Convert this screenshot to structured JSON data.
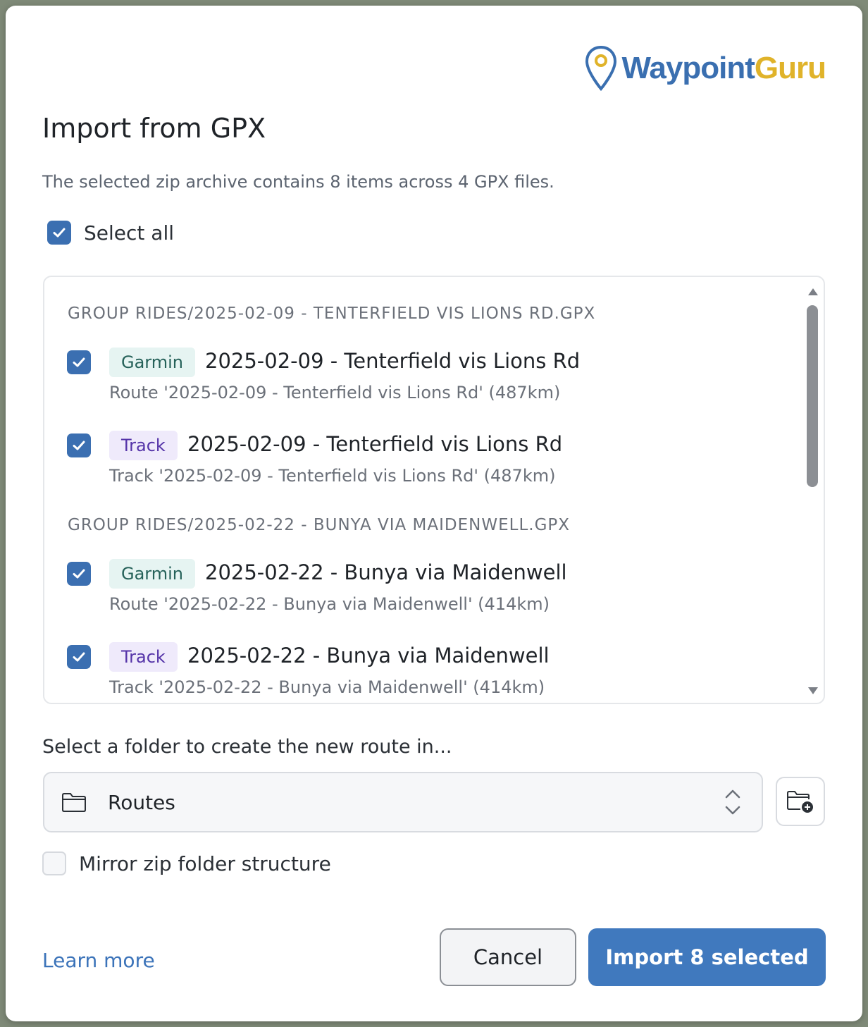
{
  "logo": {
    "text_part1": "Waypoint",
    "text_part2": "Guru"
  },
  "dialog": {
    "title": "Import from GPX",
    "subtitle": "The selected zip archive contains 8 items across 4 GPX files.",
    "select_all_label": "Select all",
    "select_all_checked": true
  },
  "groups": [
    {
      "heading": "GROUP RIDES/2025-02-09 - TENTERFIELD VIS LIONS RD.GPX",
      "items": [
        {
          "badge": "Garmin",
          "title": "2025-02-09 - Tenterfield vis Lions Rd",
          "desc": "Route '2025-02-09 - Tenterfield vis Lions Rd' (487km)",
          "checked": true
        },
        {
          "badge": "Track",
          "title": "2025-02-09 - Tenterfield vis Lions Rd",
          "desc": "Track '2025-02-09 - Tenterfield vis Lions Rd' (487km)",
          "checked": true
        }
      ]
    },
    {
      "heading": "GROUP RIDES/2025-02-22 - BUNYA VIA MAIDENWELL.GPX",
      "items": [
        {
          "badge": "Garmin",
          "title": "2025-02-22 - Bunya via Maidenwell",
          "desc": "Route '2025-02-22 - Bunya via Maidenwell' (414km)",
          "checked": true
        },
        {
          "badge": "Track",
          "title": "2025-02-22 - Bunya via Maidenwell",
          "desc": "Track '2025-02-22 - Bunya via Maidenwell' (414km)",
          "checked": true
        }
      ]
    }
  ],
  "folder": {
    "label": "Select a folder to create the new route in...",
    "selected": "Routes"
  },
  "mirror": {
    "label": "Mirror zip folder structure",
    "checked": false
  },
  "footer": {
    "learn_more": "Learn more",
    "cancel": "Cancel",
    "import": "Import 8 selected"
  },
  "colors": {
    "accent": "#4079be",
    "checkbox": "#3b6fb1",
    "garmin_badge_bg": "#e6f4f2",
    "track_badge_bg": "#efeafb",
    "logo_blue": "#3a6fb0",
    "logo_gold": "#e0b32a"
  },
  "icons": [
    "map-pin-icon",
    "check-icon",
    "folder-icon",
    "chevron-up-down-icon",
    "new-folder-icon",
    "scroll-up-arrow",
    "scroll-down-arrow"
  ]
}
